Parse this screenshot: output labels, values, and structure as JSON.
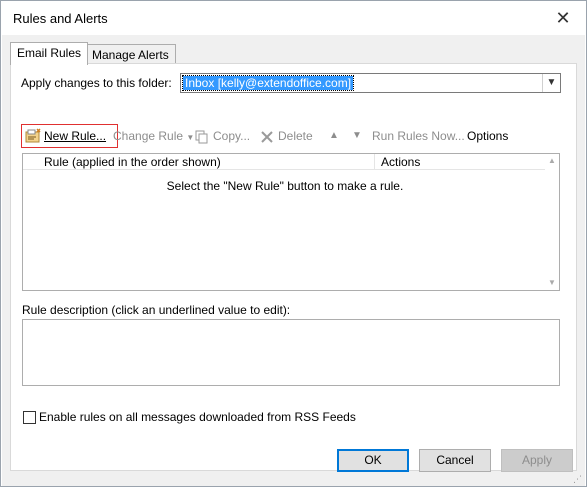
{
  "window": {
    "title": "Rules and Alerts",
    "close_glyph": "✕"
  },
  "tabs": [
    {
      "label": "Email Rules",
      "active": true
    },
    {
      "label": "Manage Alerts",
      "active": false
    }
  ],
  "folder": {
    "label": "Apply changes to this folder:",
    "value": "Inbox [kelly@extendoffice.com]"
  },
  "toolbar": {
    "new_rule": "New Rule...",
    "change_rule": "Change Rule",
    "copy": "Copy...",
    "delete": "Delete",
    "run_rules_now": "Run Rules Now...",
    "options": "Options"
  },
  "rules_list": {
    "columns": [
      "Rule (applied in the order shown)",
      "Actions"
    ],
    "empty_message": "Select the \"New Rule\" button to make a rule.",
    "rows": []
  },
  "description": {
    "label": "Rule description (click an underlined value to edit):",
    "value": ""
  },
  "rss_option": {
    "label": "Enable rules on all messages downloaded from RSS Feeds",
    "checked": false
  },
  "buttons": {
    "ok": "OK",
    "cancel": "Cancel",
    "apply": "Apply"
  },
  "colors": {
    "highlight_border": "#e03030",
    "selection": "#3399ff",
    "default_button_border": "#0078d7"
  }
}
